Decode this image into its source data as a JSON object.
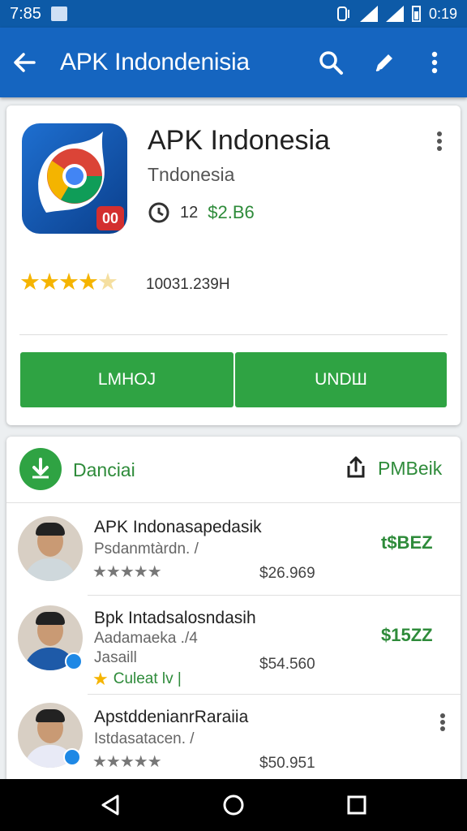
{
  "status_bar": {
    "time": "7:85",
    "right_text": "0:19",
    "notification_icon": "image-icon"
  },
  "app_bar": {
    "title": "APK Indondenisia",
    "icons": [
      "back-arrow-icon",
      "search-icon",
      "edit-icon",
      "overflow-menu-icon"
    ]
  },
  "app_card": {
    "title": "APK Indonesia",
    "subtitle": "Tndonesia",
    "meta_number": "12",
    "price": "$2.B6",
    "rating_text": "10031.239H",
    "button_left": "LМНОJ",
    "button_right": "UNDШ",
    "colors": {
      "accent": "#2fa343",
      "appbar": "#1565c0",
      "star": "#f5b400"
    }
  },
  "list_card": {
    "header_left": "Danciai",
    "header_right": "PMBeik",
    "items": [
      {
        "title": "APK Indonasapedasik",
        "subtitle": "Psdanmtàrdn. /",
        "stars": "★★★★★",
        "price": "$26.969",
        "action": "t$BEZ"
      },
      {
        "title": "Bpk Intadsalosndasih",
        "subtitle": "Aadamaeka ./4",
        "subtitle2": "Jasaill",
        "feature": "Culeat lv |",
        "price": "$54.560",
        "action": "$15ZZ"
      },
      {
        "title": "ApstddenianrRaraiia",
        "subtitle": "Istdasatacen. /",
        "stars": "★★★★★",
        "price": "$50.951"
      }
    ]
  },
  "nav_bar": {
    "icons": [
      "back-triangle-icon",
      "home-circle-icon",
      "recents-square-icon"
    ]
  }
}
